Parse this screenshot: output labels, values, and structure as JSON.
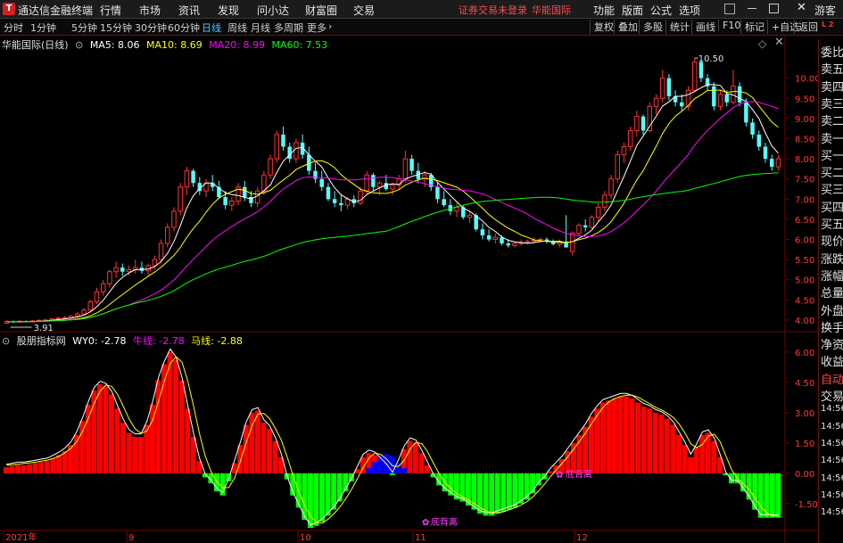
{
  "titlebar": {
    "app_title": "通达信金融终端",
    "menus": [
      "行情",
      "市场",
      "资讯",
      "发现",
      "问小达",
      "财富圈",
      "交易"
    ],
    "alert": "证券交易未登录",
    "stock_name": "华能国际",
    "right_menus": [
      "功能",
      "版面",
      "公式",
      "选项"
    ],
    "user": "游客"
  },
  "toolbar": {
    "periods": [
      "分时",
      "1分钟",
      "5分钟",
      "15分钟",
      "30分钟",
      "60分钟",
      "日线",
      "周线",
      "月线",
      "多周期",
      "更多"
    ],
    "active_period": "日线",
    "right_buttons": [
      "复权",
      "叠加",
      "多股",
      "统计",
      "画线",
      "F10",
      "标记",
      "+自选",
      "返回"
    ]
  },
  "main_legend": {
    "title": "华能国际(日线)",
    "ma5": "MA5: 8.06",
    "ma10": "MA10: 8.69",
    "ma20": "MA20: 8.99",
    "ma60": "MA60: 7.53"
  },
  "indicator_legend": {
    "title": "股朋指标网",
    "wy0": "WY0: -2.78",
    "niu": "牛线: -2.78",
    "ma": "马线: -2.88"
  },
  "colors": {
    "up": "#ff3232",
    "down": "#54ffff",
    "ma5": "#ffffff",
    "ma10": "#ffff00",
    "ma20": "#ff00ff",
    "ma60": "#00ff00",
    "hist_up": "#ff0000",
    "hist_down": "#00ff00",
    "hist_blue": "#0000ff",
    "grid": "#7a0000"
  },
  "right_panel": {
    "items": [
      "委比",
      "卖五",
      "卖四",
      "卖三",
      "卖二",
      "卖一",
      "买一",
      "买二",
      "买三",
      "买四",
      "买五",
      "现价",
      "涨跌",
      "涨幅",
      "总量",
      "外盘",
      "换手",
      "净资",
      "收益",
      "自动",
      "交易",
      "14:56",
      "14:56",
      "14:56",
      "14:56",
      "14:56",
      "14:56",
      "14:56"
    ]
  },
  "chart_data": [
    {
      "type": "candlestick",
      "title": "华能国际(日线)",
      "price_axis_ticks": [
        "10.00",
        "9.50",
        "9.00",
        "8.50",
        "8.00",
        "7.50",
        "7.00",
        "6.50",
        "6.00",
        "5.50",
        "5.00",
        "4.50",
        "4.00"
      ],
      "ylim": [
        3.8,
        10.7
      ],
      "annotations": [
        {
          "label": "10.50",
          "value": 10.5
        },
        {
          "label": "3.91",
          "value": 3.91
        }
      ],
      "x_labels": [
        "2021年",
        "9",
        "10",
        "11",
        "12"
      ],
      "ohlc": [
        [
          3.92,
          4.0,
          3.91,
          3.96
        ],
        [
          3.96,
          3.99,
          3.93,
          3.95
        ],
        [
          3.95,
          4.0,
          3.93,
          3.97
        ],
        [
          3.97,
          3.99,
          3.94,
          3.96
        ],
        [
          3.96,
          4.0,
          3.94,
          3.98
        ],
        [
          3.98,
          4.02,
          3.95,
          3.99
        ],
        [
          3.99,
          4.03,
          3.96,
          4.0
        ],
        [
          4.0,
          4.05,
          3.97,
          4.03
        ],
        [
          4.03,
          4.08,
          4.0,
          4.05
        ],
        [
          4.05,
          4.1,
          4.02,
          4.06
        ],
        [
          4.06,
          4.12,
          4.03,
          4.1
        ],
        [
          4.1,
          4.2,
          4.07,
          4.15
        ],
        [
          4.15,
          4.3,
          4.12,
          4.25
        ],
        [
          4.25,
          4.5,
          4.2,
          4.45
        ],
        [
          4.45,
          4.8,
          4.4,
          4.7
        ],
        [
          4.7,
          5.0,
          4.6,
          4.9
        ],
        [
          4.9,
          5.25,
          4.8,
          5.2
        ],
        [
          5.2,
          5.45,
          5.05,
          5.3
        ],
        [
          5.3,
          5.4,
          5.1,
          5.2
        ],
        [
          5.2,
          5.35,
          5.1,
          5.25
        ],
        [
          5.25,
          5.5,
          5.15,
          5.3
        ],
        [
          5.3,
          5.45,
          5.15,
          5.22
        ],
        [
          5.22,
          5.4,
          5.1,
          5.35
        ],
        [
          5.35,
          5.6,
          5.25,
          5.5
        ],
        [
          5.5,
          6.0,
          5.4,
          5.9
        ],
        [
          5.9,
          6.4,
          5.8,
          6.3
        ],
        [
          6.3,
          6.8,
          6.2,
          6.7
        ],
        [
          6.7,
          7.4,
          6.6,
          7.3
        ],
        [
          7.3,
          7.8,
          7.1,
          7.7
        ],
        [
          7.7,
          7.75,
          7.3,
          7.4
        ],
        [
          7.4,
          7.55,
          7.1,
          7.2
        ],
        [
          7.2,
          7.5,
          7.05,
          7.4
        ],
        [
          7.4,
          7.6,
          7.2,
          7.3
        ],
        [
          7.3,
          7.45,
          7.0,
          7.05
        ],
        [
          7.05,
          7.2,
          6.75,
          6.85
        ],
        [
          6.85,
          7.05,
          6.7,
          6.95
        ],
        [
          6.95,
          7.4,
          6.85,
          7.3
        ],
        [
          7.3,
          7.45,
          6.95,
          7.05
        ],
        [
          7.05,
          7.2,
          6.8,
          6.9
        ],
        [
          6.9,
          7.3,
          6.8,
          7.2
        ],
        [
          7.2,
          7.7,
          7.1,
          7.6
        ],
        [
          7.6,
          8.1,
          7.5,
          8.0
        ],
        [
          8.0,
          8.7,
          7.9,
          8.6
        ],
        [
          8.6,
          8.8,
          8.2,
          8.3
        ],
        [
          8.3,
          8.4,
          7.9,
          8.0
        ],
        [
          8.0,
          8.5,
          7.9,
          8.4
        ],
        [
          8.4,
          8.6,
          8.0,
          8.1
        ],
        [
          8.1,
          8.3,
          7.6,
          7.7
        ],
        [
          7.7,
          7.9,
          7.4,
          7.5
        ],
        [
          7.5,
          7.7,
          7.2,
          7.3
        ],
        [
          7.3,
          7.4,
          6.95,
          7.0
        ],
        [
          7.0,
          7.2,
          6.8,
          6.9
        ],
        [
          6.9,
          7.1,
          6.7,
          6.85
        ],
        [
          6.85,
          7.05,
          6.75,
          7.0
        ],
        [
          7.0,
          7.1,
          6.8,
          6.9
        ],
        [
          6.9,
          7.3,
          6.85,
          7.2
        ],
        [
          7.2,
          7.7,
          7.1,
          7.6
        ],
        [
          7.6,
          7.65,
          7.2,
          7.3
        ],
        [
          7.3,
          7.45,
          7.1,
          7.4
        ],
        [
          7.4,
          7.6,
          7.2,
          7.25
        ],
        [
          7.25,
          7.4,
          7.1,
          7.35
        ],
        [
          7.35,
          7.6,
          7.25,
          7.5
        ],
        [
          7.5,
          8.2,
          7.4,
          8.0
        ],
        [
          8.0,
          8.1,
          7.6,
          7.7
        ],
        [
          7.7,
          7.9,
          7.4,
          7.5
        ],
        [
          7.5,
          7.7,
          7.3,
          7.6
        ],
        [
          7.6,
          7.65,
          7.2,
          7.3
        ],
        [
          7.3,
          7.4,
          6.9,
          7.0
        ],
        [
          7.0,
          7.2,
          6.8,
          6.85
        ],
        [
          6.85,
          7.0,
          6.6,
          6.7
        ],
        [
          6.7,
          6.9,
          6.55,
          6.8
        ],
        [
          6.8,
          6.85,
          6.5,
          6.55
        ],
        [
          6.55,
          6.7,
          6.4,
          6.6
        ],
        [
          6.6,
          6.65,
          6.2,
          6.25
        ],
        [
          6.25,
          6.4,
          6.0,
          6.1
        ],
        [
          6.1,
          6.25,
          5.95,
          6.0
        ],
        [
          6.0,
          6.15,
          5.9,
          6.05
        ],
        [
          6.05,
          6.1,
          5.85,
          5.9
        ],
        [
          5.9,
          6.0,
          5.8,
          5.85
        ],
        [
          5.85,
          5.95,
          5.8,
          5.9
        ],
        [
          5.9,
          6.0,
          5.85,
          5.92
        ],
        [
          5.92,
          6.0,
          5.88,
          5.95
        ],
        [
          5.95,
          6.05,
          5.9,
          5.98
        ],
        [
          5.98,
          6.05,
          5.92,
          6.0
        ],
        [
          6.0,
          6.05,
          5.9,
          5.95
        ],
        [
          5.95,
          6.0,
          5.85,
          5.88
        ],
        [
          5.88,
          6.0,
          5.8,
          5.95
        ],
        [
          5.95,
          6.6,
          5.9,
          5.8
        ],
        [
          5.7,
          6.2,
          5.6,
          6.15
        ],
        [
          6.15,
          6.4,
          6.1,
          6.35
        ],
        [
          6.35,
          6.5,
          6.2,
          6.3
        ],
        [
          6.3,
          6.6,
          6.25,
          6.55
        ],
        [
          6.55,
          6.9,
          6.45,
          6.8
        ],
        [
          6.8,
          7.2,
          6.7,
          7.1
        ],
        [
          7.1,
          7.6,
          7.0,
          7.5
        ],
        [
          7.5,
          8.2,
          7.4,
          8.1
        ],
        [
          8.1,
          8.4,
          7.9,
          8.3
        ],
        [
          8.3,
          8.8,
          8.2,
          8.7
        ],
        [
          8.7,
          9.2,
          8.55,
          9.05
        ],
        [
          9.05,
          9.1,
          8.6,
          8.7
        ],
        [
          8.7,
          9.4,
          8.65,
          9.3
        ],
        [
          9.3,
          9.6,
          9.1,
          9.5
        ],
        [
          9.5,
          10.2,
          9.4,
          10.0
        ],
        [
          10.0,
          10.1,
          9.45,
          9.55
        ],
        [
          9.55,
          9.7,
          9.3,
          9.4
        ],
        [
          9.4,
          9.6,
          9.2,
          9.3
        ],
        [
          9.3,
          9.8,
          9.2,
          9.7
        ],
        [
          9.7,
          10.5,
          9.65,
          10.4
        ],
        [
          10.4,
          10.45,
          9.9,
          10.0
        ],
        [
          10.0,
          10.1,
          9.7,
          9.8
        ],
        [
          9.8,
          9.9,
          9.2,
          9.3
        ],
        [
          9.3,
          9.7,
          9.2,
          9.6
        ],
        [
          9.6,
          9.7,
          9.3,
          9.4
        ],
        [
          9.4,
          10.2,
          9.35,
          9.8
        ],
        [
          9.8,
          9.9,
          9.3,
          9.4
        ],
        [
          9.4,
          9.5,
          8.8,
          8.9
        ],
        [
          8.9,
          9.0,
          8.5,
          8.6
        ],
        [
          8.6,
          8.7,
          8.2,
          8.3
        ],
        [
          8.3,
          8.4,
          7.9,
          8.0
        ],
        [
          8.0,
          8.1,
          7.7,
          7.8
        ],
        [
          7.8,
          8.1,
          7.7,
          8.0
        ]
      ]
    },
    {
      "type": "bar",
      "title": "股朋指标网",
      "y_axis_ticks": [
        "6.00",
        "4.50",
        "3.00",
        "1.50",
        "0.00",
        "-1.50"
      ],
      "ylim": [
        -2.7,
        6.3
      ],
      "annotations": [
        {
          "label": "底背离",
          "value": -2.4
        },
        {
          "label": "底背离",
          "value": 0.05
        }
      ],
      "values": [
        0.3,
        0.35,
        0.4,
        0.4,
        0.45,
        0.5,
        0.55,
        0.6,
        0.75,
        0.9,
        1.1,
        1.4,
        1.9,
        2.6,
        3.4,
        4.1,
        4.4,
        4.3,
        3.9,
        3.2,
        2.5,
        2.0,
        1.8,
        1.8,
        2.4,
        3.4,
        4.6,
        5.4,
        6.0,
        5.6,
        4.6,
        3.2,
        1.8,
        0.6,
        -0.2,
        -0.5,
        -0.9,
        -1.1,
        -0.4,
        0.5,
        1.4,
        2.4,
        3.0,
        3.1,
        2.5,
        2.2,
        1.6,
        0.8,
        -0.3,
        -1.1,
        -1.7,
        -2.3,
        -2.7,
        -2.6,
        -2.4,
        -2.1,
        -1.8,
        -1.4,
        -0.9,
        -0.4,
        0.2,
        0.8,
        1.0,
        0.9,
        0.6,
        0.3,
        -0.1,
        0.5,
        1.2,
        1.6,
        1.5,
        1.0,
        0.4,
        -0.2,
        -0.6,
        -0.9,
        -1.1,
        -1.3,
        -1.4,
        -1.6,
        -1.8,
        -2.0,
        -2.1,
        -2.1,
        -2.0,
        -1.9,
        -1.8,
        -1.7,
        -1.5,
        -1.3,
        -1.0,
        -0.6,
        -0.3,
        0.1,
        0.4,
        0.7,
        1.1,
        1.5,
        1.9,
        2.3,
        2.8,
        3.2,
        3.5,
        3.6,
        3.7,
        3.8,
        3.8,
        3.7,
        3.5,
        3.3,
        3.2,
        3.0,
        2.9,
        2.7,
        2.4,
        1.9,
        1.4,
        0.8,
        1.3,
        1.9,
        2.0,
        1.6,
        0.8,
        -0.1,
        -0.5,
        -0.5,
        -0.9,
        -1.3,
        -1.8,
        -2.2,
        -2.2,
        -2.2,
        -2.2
      ],
      "blue_overlay": {
        "start": 62,
        "values": [
          0.25,
          0.55,
          0.9,
          0.95,
          0.85,
          0.5,
          0.25
        ]
      }
    }
  ]
}
